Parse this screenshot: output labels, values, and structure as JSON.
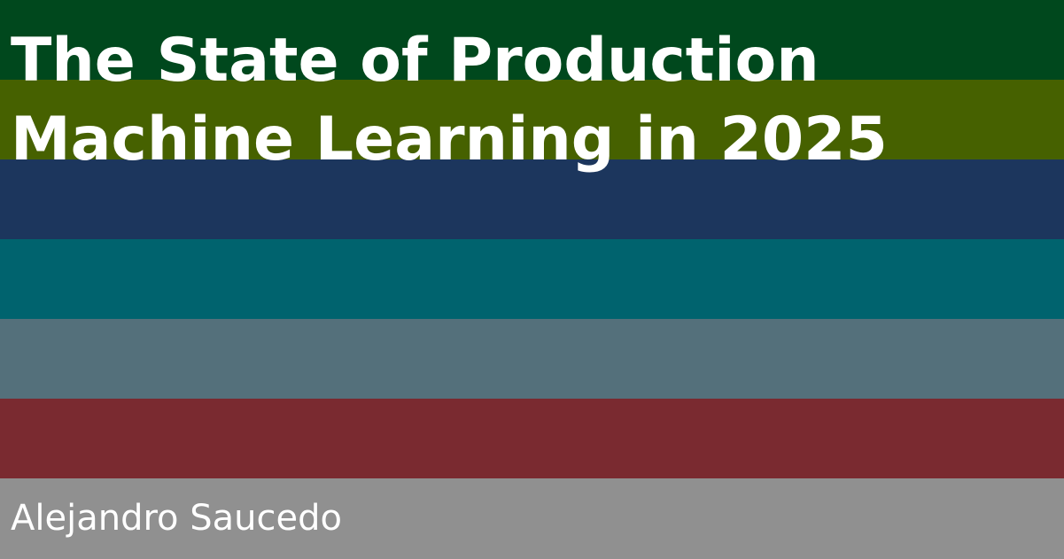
{
  "card": {
    "title_lines": [
      "The State of Production",
      "Machine Learning in 2025"
    ],
    "author": "Alejandro Saucedo",
    "band_colors": [
      "#00481d",
      "#466100",
      "#1c365d",
      "#00636e",
      "#54707b",
      "#7a2a30",
      "#909090"
    ]
  }
}
